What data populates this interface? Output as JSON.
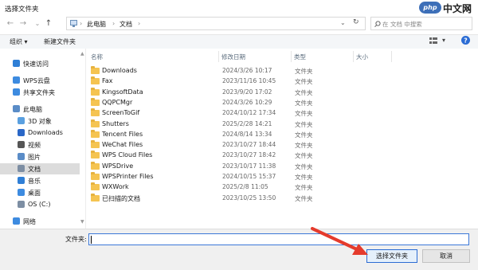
{
  "window": {
    "title": "选择文件夹"
  },
  "watermark": {
    "logo": "php",
    "text": "中文网"
  },
  "address": {
    "crumbs": [
      "此电脑",
      "文档"
    ],
    "separator": "›",
    "search_placeholder": "在 文档 中搜索"
  },
  "toolbar": {
    "organize": "组织 ▾",
    "new_folder": "新建文件夹"
  },
  "nav": {
    "items": [
      {
        "label": "快速访问",
        "icon": "star-icon"
      },
      {
        "label": "WPS云盘",
        "icon": "cloud-icon"
      },
      {
        "label": "共享文件夹",
        "icon": "shared-folder-icon"
      },
      {
        "label": "此电脑",
        "icon": "computer-icon"
      },
      {
        "label": "3D 对象",
        "icon": "cube-icon"
      },
      {
        "label": "Downloads",
        "icon": "download-icon"
      },
      {
        "label": "视频",
        "icon": "video-icon"
      },
      {
        "label": "图片",
        "icon": "picture-icon"
      },
      {
        "label": "文档",
        "icon": "document-icon",
        "selected": true
      },
      {
        "label": "音乐",
        "icon": "music-icon"
      },
      {
        "label": "桌面",
        "icon": "desktop-icon"
      },
      {
        "label": "OS (C:)",
        "icon": "drive-icon"
      },
      {
        "label": "网络",
        "icon": "network-icon"
      }
    ]
  },
  "columns": {
    "name": "名称",
    "date": "修改日期",
    "type": "类型",
    "size": "大小"
  },
  "files": [
    {
      "name": "Downloads",
      "date": "2024/3/26 10:17",
      "type": "文件夹"
    },
    {
      "name": "Fax",
      "date": "2023/11/16 10:45",
      "type": "文件夹"
    },
    {
      "name": "KingsoftData",
      "date": "2023/9/20 17:02",
      "type": "文件夹"
    },
    {
      "name": "QQPCMgr",
      "date": "2024/3/26 10:29",
      "type": "文件夹"
    },
    {
      "name": "ScreenToGif",
      "date": "2024/10/12 17:34",
      "type": "文件夹"
    },
    {
      "name": "Shutters",
      "date": "2025/2/28 14:21",
      "type": "文件夹"
    },
    {
      "name": "Tencent Files",
      "date": "2024/8/14 13:34",
      "type": "文件夹"
    },
    {
      "name": "WeChat Files",
      "date": "2023/10/27 18:44",
      "type": "文件夹"
    },
    {
      "name": "WPS Cloud Files",
      "date": "2023/10/27 18:42",
      "type": "文件夹"
    },
    {
      "name": "WPSDrive",
      "date": "2023/10/17 11:38",
      "type": "文件夹"
    },
    {
      "name": "WPSPrinter Files",
      "date": "2024/10/15 15:37",
      "type": "文件夹"
    },
    {
      "name": "WXWork",
      "date": "2025/2/8 11:05",
      "type": "文件夹"
    },
    {
      "name": "已扫描的文档",
      "date": "2023/10/25 13:50",
      "type": "文件夹"
    }
  ],
  "footer": {
    "folder_label": "文件夹:",
    "folder_value": "",
    "select_button": "选择文件夹",
    "cancel_button": "取消"
  },
  "colors": {
    "accent": "#2b6cd4",
    "folder": "#f5c451",
    "arrow": "#e53b2c"
  }
}
